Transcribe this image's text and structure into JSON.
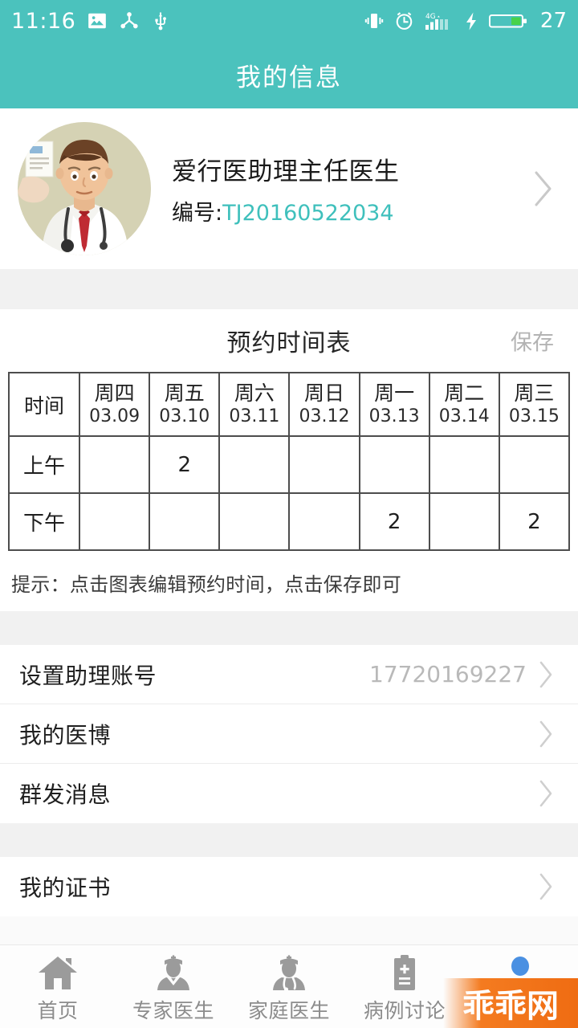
{
  "statusbar": {
    "time": "11:16",
    "left_icons": [
      "image-icon",
      "share-icon",
      "usb-icon"
    ],
    "right_icons": [
      "vibrate-icon",
      "alarm-icon",
      "signal-4g-icon",
      "charging-bolt-icon",
      "battery-icon"
    ],
    "network": "4G",
    "battery_level": "27"
  },
  "header": {
    "title": "我的信息",
    "accent_color": "#4bc2bd"
  },
  "profile": {
    "avatar_name": "doctor-avatar",
    "name": "爱行医助理主任医生",
    "id_label": "编号:",
    "id_value": "TJ20160522034",
    "id_color": "#3fc0bc"
  },
  "schedule": {
    "title": "预约时间表",
    "save_label": "保存",
    "hint": "提示：点击图表编辑预约时间，点击保存即可",
    "highlight_color": "#7fd5d1",
    "corner_header": "时间",
    "columns": [
      {
        "day": "周四",
        "date": "03.09"
      },
      {
        "day": "周五",
        "date": "03.10"
      },
      {
        "day": "周六",
        "date": "03.11"
      },
      {
        "day": "周日",
        "date": "03.12"
      },
      {
        "day": "周一",
        "date": "03.13"
      },
      {
        "day": "周二",
        "date": "03.14"
      },
      {
        "day": "周三",
        "date": "03.15"
      }
    ],
    "rows": [
      {
        "label": "上午",
        "cells": [
          "",
          "2",
          "",
          "",
          "",
          "",
          ""
        ]
      },
      {
        "label": "下午",
        "cells": [
          "",
          "",
          "",
          "",
          "2",
          "",
          "2"
        ]
      }
    ]
  },
  "menu_group_1": [
    {
      "title": "设置助理账号",
      "value": "17720169227"
    },
    {
      "title": "我的医博",
      "value": ""
    },
    {
      "title": "群发消息",
      "value": ""
    }
  ],
  "menu_group_2": [
    {
      "title": "我的证书",
      "value": ""
    }
  ],
  "tabbar": {
    "items": [
      {
        "label": "首页",
        "icon": "home-icon"
      },
      {
        "label": "专家医生",
        "icon": "expert-doctor-icon"
      },
      {
        "label": "家庭医生",
        "icon": "family-doctor-icon"
      },
      {
        "label": "病例讨论",
        "icon": "clipboard-case-icon"
      },
      {
        "label": "",
        "icon": "user-profile-icon"
      }
    ]
  },
  "watermark": {
    "text": "乖乖网"
  }
}
